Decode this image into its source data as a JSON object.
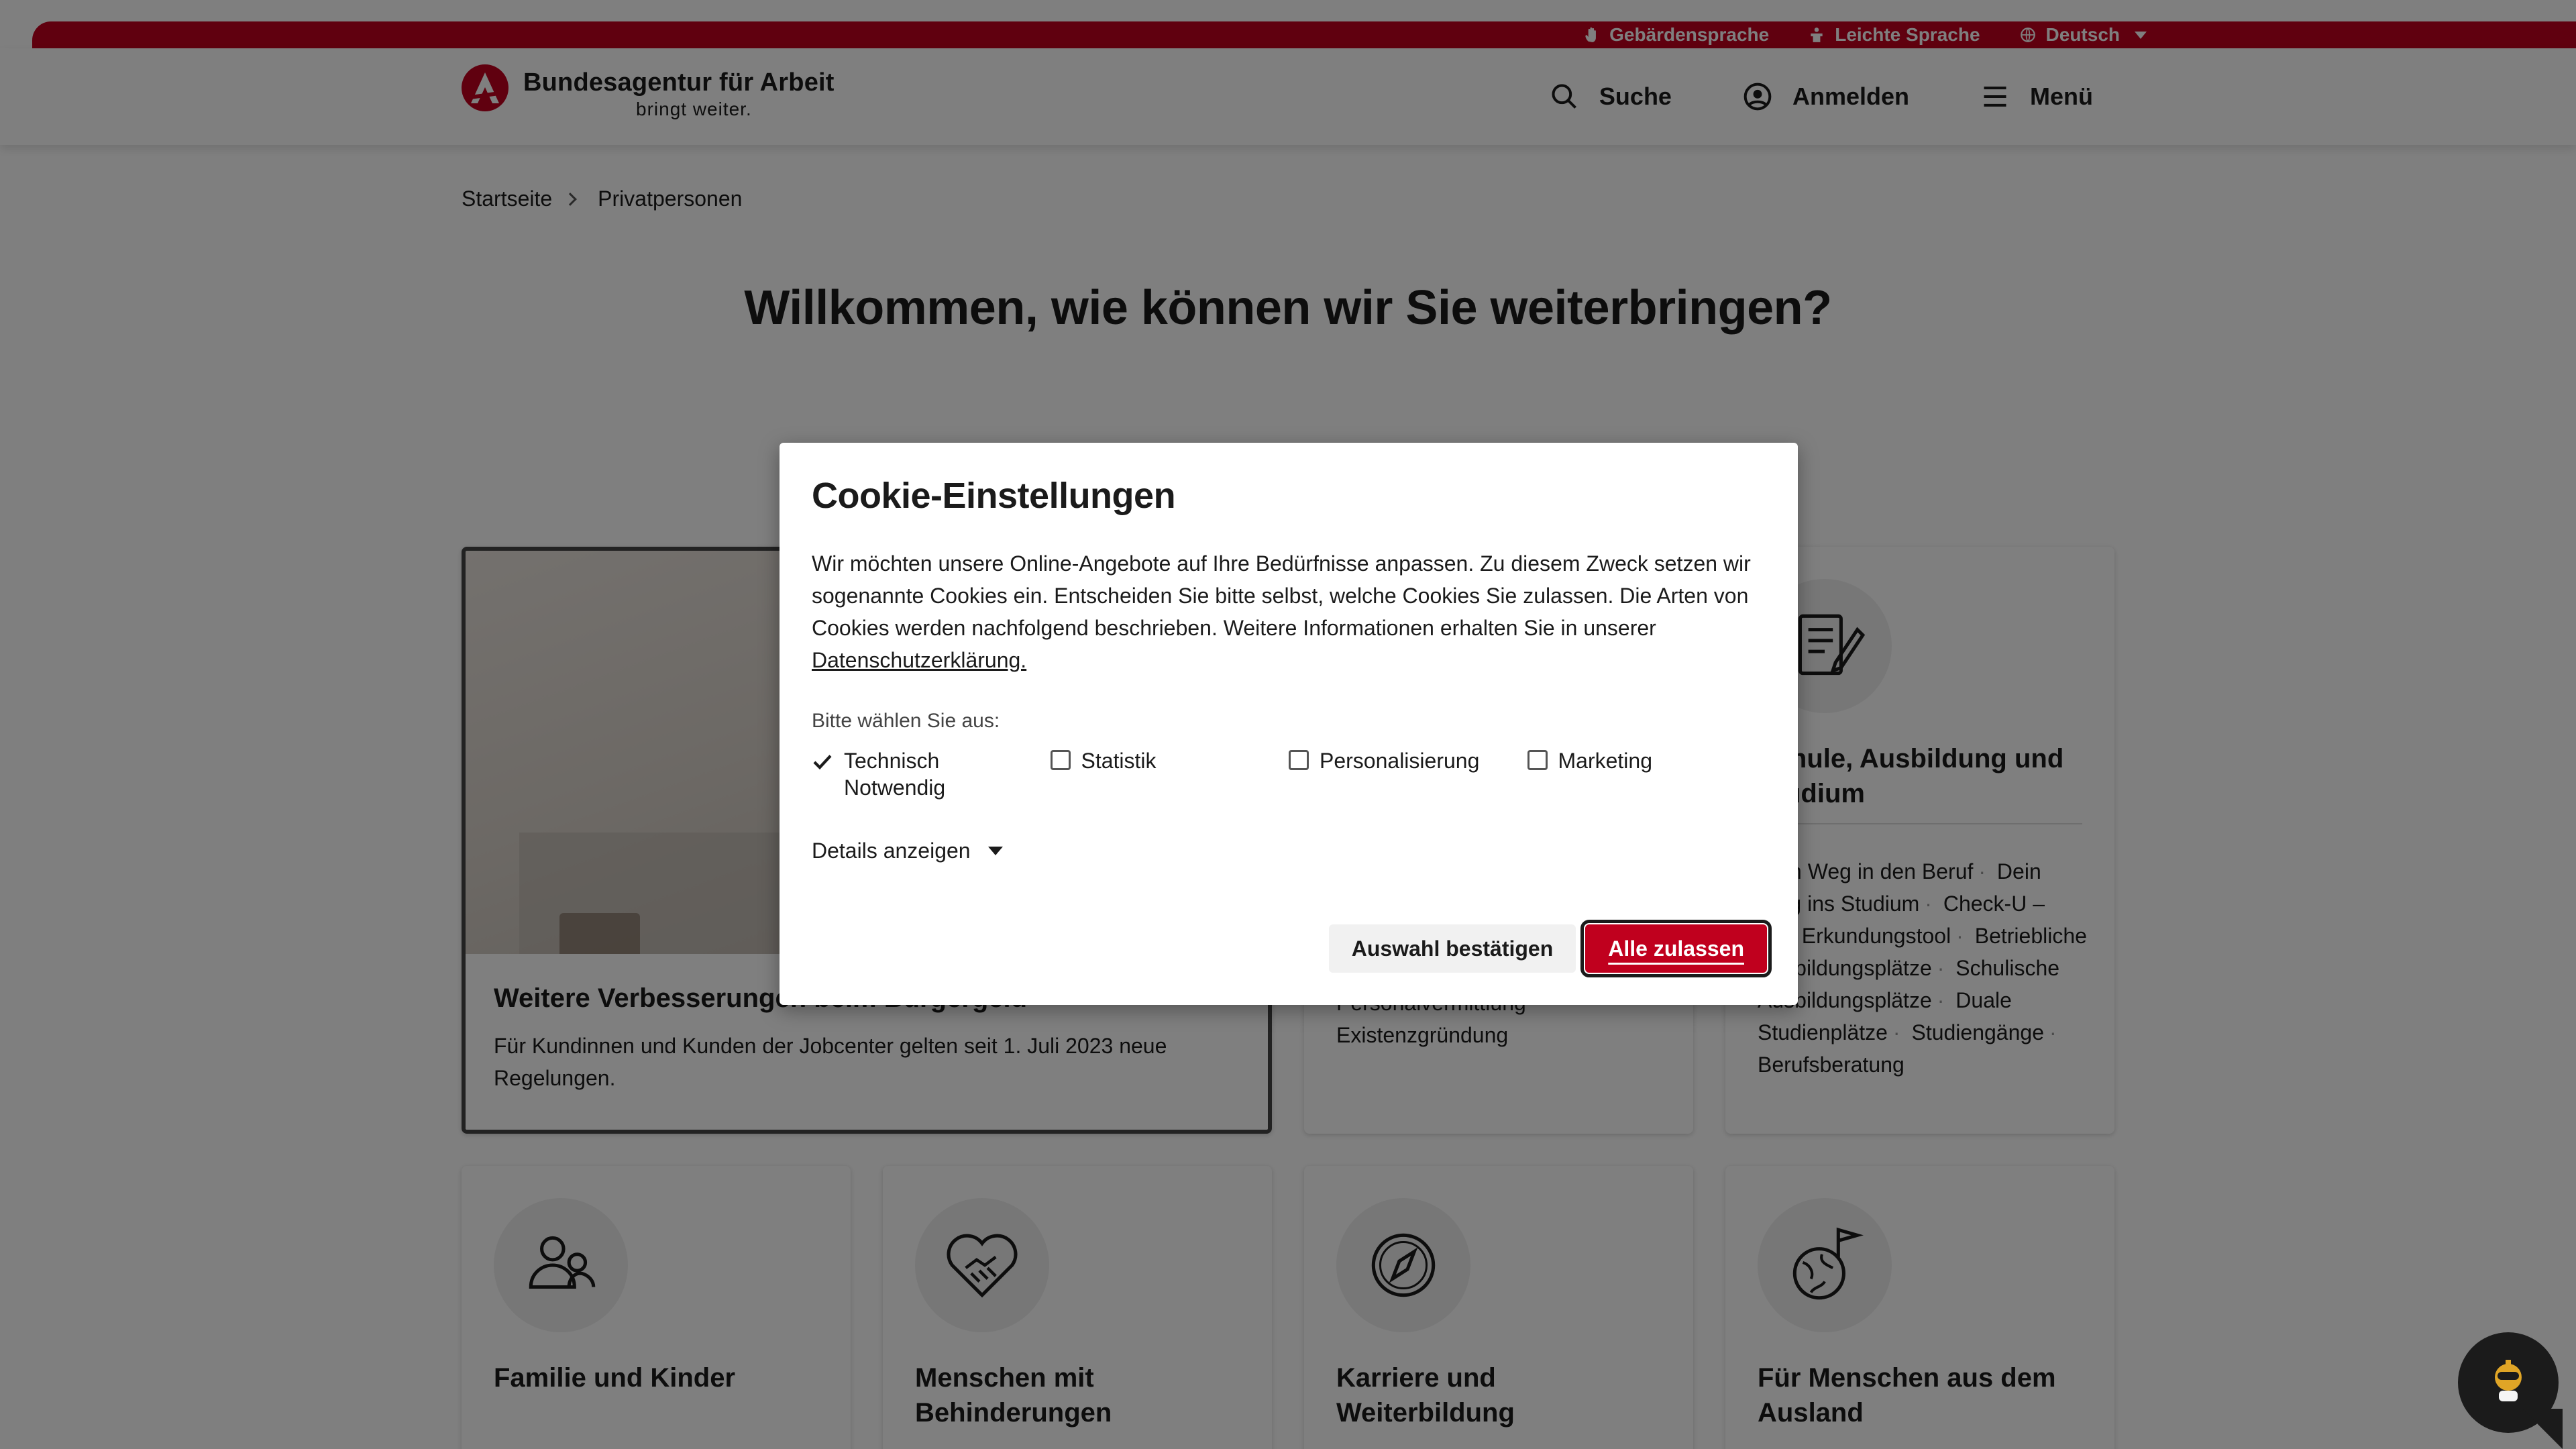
{
  "topbar": {
    "links": [
      "Gebärdensprache",
      "Leichte Sprache",
      "Deutsch"
    ]
  },
  "header": {
    "logo_title": "Bundesagentur für Arbeit",
    "logo_sub": "bringt weiter.",
    "nav": {
      "search": "Suche",
      "login": "Anmelden",
      "menu": "Menü"
    }
  },
  "breadcrumb": [
    "Startseite",
    "Privatpersonen"
  ],
  "headline": "Willkommen, wie können wir Sie weiterbringen?",
  "feature": {
    "title": "Weitere Verbesserungen beim Bürgergeld",
    "text": "Für Kundinnen und Kunden der Jobcenter gelten seit 1. Juli 2023 neue Regelungen."
  },
  "tiles": {
    "arbeit": {
      "links": [
        "Personalvermittlung",
        "Existenzgründung"
      ]
    },
    "schule": {
      "title": "Schule, Ausbildung und Studium",
      "links": [
        "Dein Weg in den Beruf",
        "Dein Weg ins Studium",
        "Check-U – Das Erkundungstool",
        "Betriebliche Ausbildungsplätze",
        "Schulische Ausbildungsplätze",
        "Duale Studienplätze",
        "Studiengänge",
        "Berufsberatung"
      ]
    },
    "familie": {
      "title": "Familie und Kinder"
    },
    "behinderung": {
      "title": "Menschen mit Behinderungen"
    },
    "karriere": {
      "title": "Karriere und Weiterbildung"
    },
    "ausland": {
      "title": "Für Menschen aus dem Ausland"
    }
  },
  "cookie": {
    "title": "Cookie-Einstellungen",
    "text": "Wir möchten unsere Online-Angebote auf Ihre Bedürfnisse anpassen. Zu diesem Zweck setzen wir sogenannte Cookies ein. Entscheiden Sie bitte selbst, welche Cookies Sie zulassen. Die Arten von Cookies werden nachfolgend beschrieben. Weitere Informationen erhalten Sie in unserer",
    "privacy_link": "Datenschutzerklärung.",
    "choose_label": "Bitte wählen Sie aus:",
    "options": [
      "Technisch Notwendig",
      "Statistik",
      "Personalisierung",
      "Marketing"
    ],
    "details": "Details anzeigen",
    "confirm": "Auswahl bestätigen",
    "accept_all": "Alle zulassen"
  },
  "colors": {
    "brand_red": "#c0001e",
    "text": "#1b1b1b"
  }
}
